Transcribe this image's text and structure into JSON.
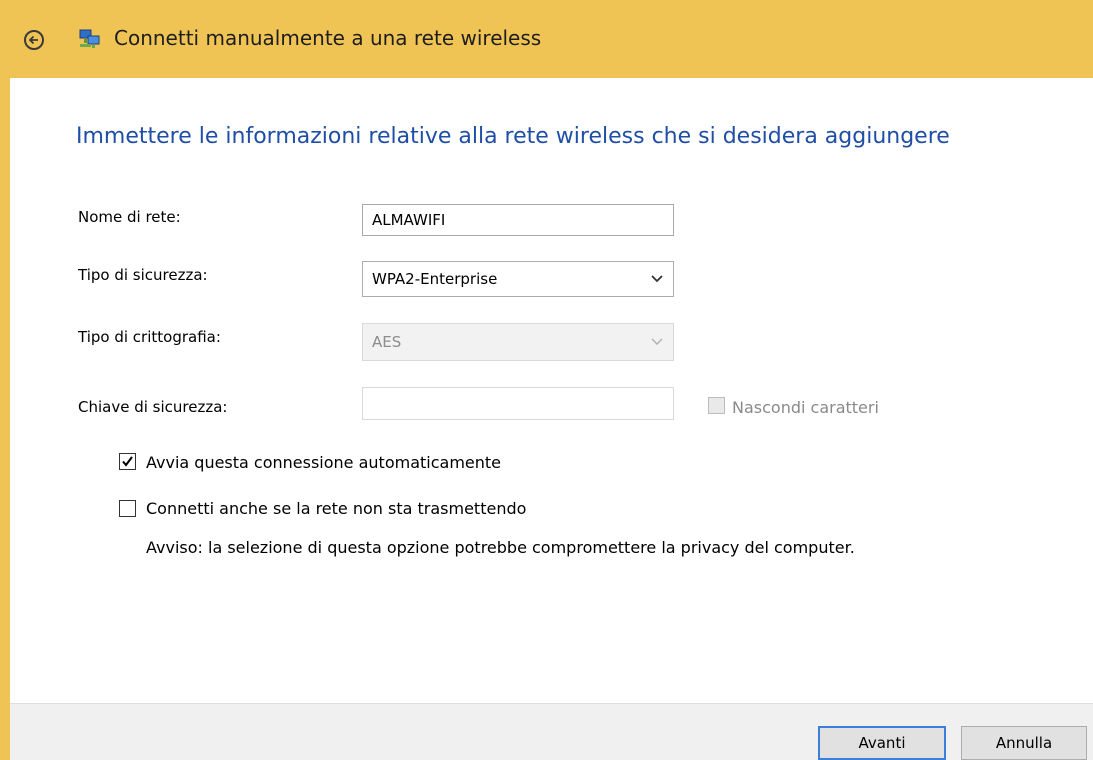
{
  "window": {
    "title": "Connetti manualmente a una rete wireless",
    "accent_color": "#f0c454"
  },
  "heading": "Immettere le informazioni relative alla rete wireless che si desidera aggiungere",
  "form": {
    "network_name": {
      "label": "Nome di rete:",
      "value": "ALMAWIFI"
    },
    "security_type": {
      "label": "Tipo di sicurezza:",
      "value": "WPA2-Enterprise"
    },
    "encryption_type": {
      "label": "Tipo di crittografia:",
      "value": "AES"
    },
    "security_key": {
      "label": "Chiave di sicurezza:",
      "value": ""
    },
    "hide_chars": {
      "label": "Nascondi caratteri",
      "checked": false,
      "enabled": false
    }
  },
  "options": {
    "auto_connect": {
      "label": "Avvia questa connessione automaticamente",
      "checked": true
    },
    "connect_hidden": {
      "label": "Connetti anche se la rete non sta trasmettendo",
      "checked": false
    },
    "warning": "Avviso: la selezione di questa opzione potrebbe compromettere la privacy del computer."
  },
  "buttons": {
    "next": "Avanti",
    "cancel": "Annulla"
  },
  "icons": {
    "back": "back-arrow-icon",
    "network": "network-icon",
    "dropdown": "chevron-down-icon",
    "check": "checkmark-icon"
  }
}
